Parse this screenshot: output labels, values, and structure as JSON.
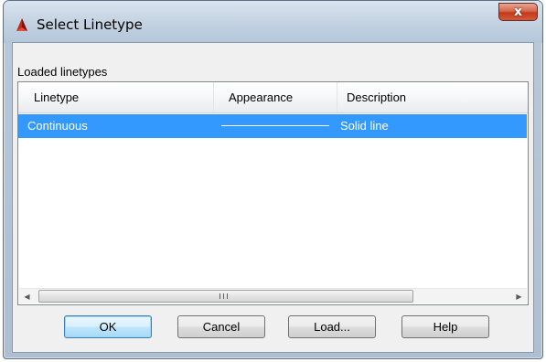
{
  "window": {
    "title": "Select Linetype",
    "close_label": "x"
  },
  "group": {
    "label": "Loaded linetypes"
  },
  "table": {
    "columns": [
      "Linetype",
      "Appearance",
      "Description"
    ],
    "rows": [
      {
        "linetype": "Continuous",
        "appearance": "solid-line-sample",
        "description": "Solid line",
        "selected": true
      }
    ]
  },
  "scrollbar": {
    "grip_label": "III"
  },
  "buttons": {
    "ok": "OK",
    "cancel": "Cancel",
    "load": "Load...",
    "help": "Help"
  },
  "colors": {
    "selection": "#3399ff",
    "close_button": "#c3391c"
  }
}
